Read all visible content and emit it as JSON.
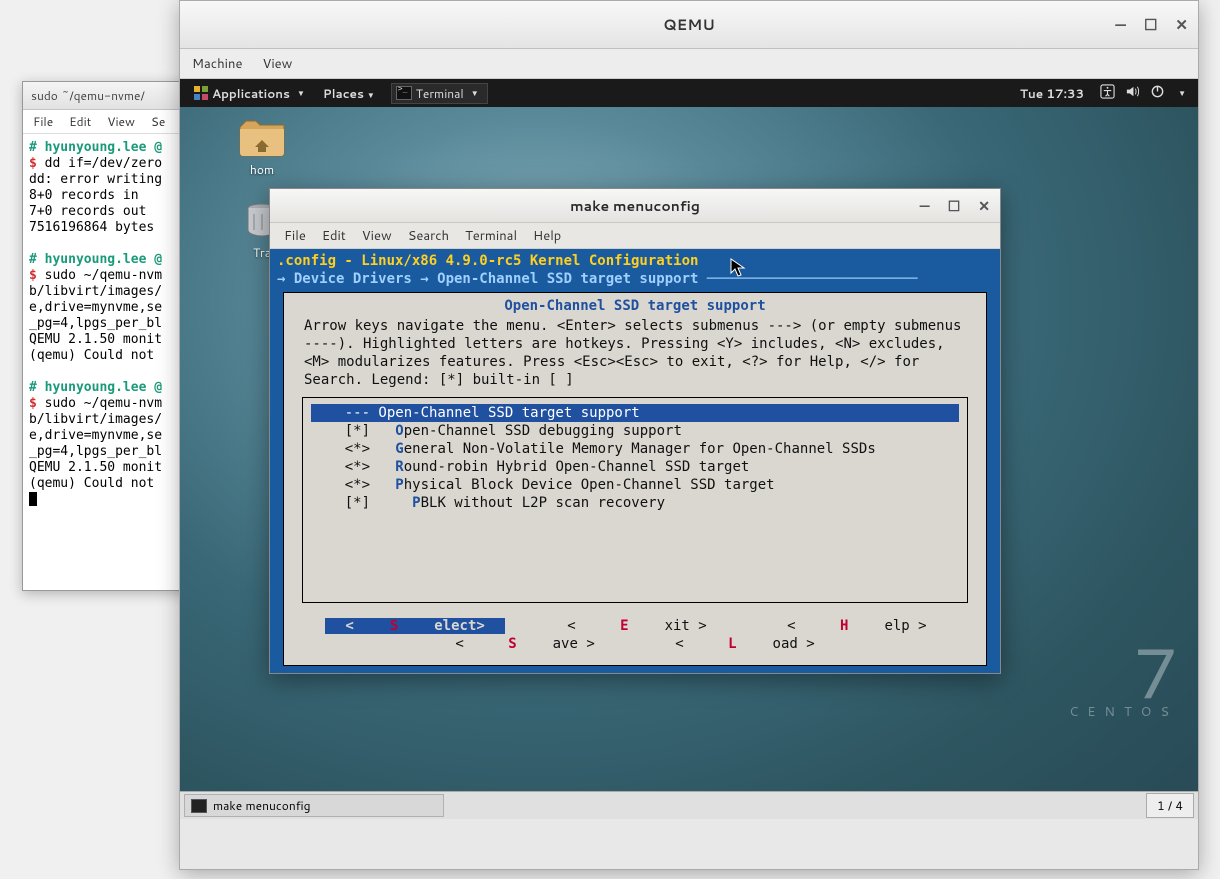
{
  "qemu": {
    "title": "QEMU",
    "menus": {
      "machine": "Machine",
      "view": "View"
    },
    "controls": {
      "min": "—",
      "max": "☐",
      "close": "✕"
    }
  },
  "gnome": {
    "apps": "Applications",
    "places": "Places",
    "terminal_launcher": "Terminal",
    "clock": "Tue 17:33",
    "desktop_icons": {
      "home": "hom",
      "trash": "Tra"
    },
    "centos": {
      "seven": "7",
      "name": "CENTOS"
    },
    "taskbar_item": "make menuconfig",
    "workspace": "1 / 4"
  },
  "menuconfig": {
    "title": "make menuconfig",
    "controls": {
      "min": "—",
      "max": "☐",
      "close": "✕"
    },
    "menubar": [
      "File",
      "Edit",
      "View",
      "Search",
      "Terminal",
      "Help"
    ],
    "header_left": " .config - Linux/x86 4.9.0-rc5 Kernel Configuration",
    "breadcrumb": "  → Device Drivers → Open-Channel SSD target support ─────────────────────────",
    "box_title": "Open-Channel SSD target support",
    "instructions": "Arrow keys navigate the menu.  <Enter> selects submenus ---> (or empty submenus ----).  Highlighted letters are hotkeys.  Pressing <Y> includes, <N> excludes, <M> modularizes features.  Press <Esc><Esc> to exit, <?> for Help, </> for Search.  Legend: [*] built-in  [ ]",
    "items": [
      {
        "mark": "---",
        "hot": "",
        "text": "Open-Channel SSD target support",
        "selected": true
      },
      {
        "mark": "[*]",
        "hot": "O",
        "text": "pen-Channel SSD debugging support"
      },
      {
        "mark": "<*>",
        "hot": "G",
        "text": "eneral Non-Volatile Memory Manager for Open-Channel SSDs"
      },
      {
        "mark": "<*>",
        "hot": "R",
        "text": "ound-robin Hybrid Open-Channel SSD target"
      },
      {
        "mark": "<*>",
        "hot": "P",
        "text": "hysical Block Device Open-Channel SSD target"
      },
      {
        "mark": "[*]",
        "hot": "P",
        "text": "BLK without L2P scan recovery",
        "indent": "  "
      }
    ],
    "buttons": {
      "select": {
        "lt": "<",
        "hot": "S",
        "rest": "elect>",
        "selected": true
      },
      "exit": {
        "pre": "< ",
        "hot": "E",
        "rest": "xit >"
      },
      "help": {
        "pre": "< ",
        "hot": "H",
        "rest": "elp >"
      },
      "save": {
        "pre": "< ",
        "hot": "S",
        "rest": "ave >"
      },
      "load": {
        "pre": "< ",
        "hot": "L",
        "rest": "oad >"
      }
    }
  },
  "host_terminal": {
    "title": "sudo ~/qemu-nvme/",
    "menus": [
      "File",
      "Edit",
      "View",
      "Se"
    ],
    "lines": [
      {
        "type": "user",
        "text": "# hyunyoung.lee @"
      },
      {
        "type": "cmd",
        "prompt": "$ ",
        "text": "dd if=/dev/zero"
      },
      {
        "type": "out",
        "text": "dd: error writing"
      },
      {
        "type": "out",
        "text": "8+0 records in"
      },
      {
        "type": "out",
        "text": "7+0 records out"
      },
      {
        "type": "out",
        "text": "7516196864 bytes "
      },
      {
        "type": "blank"
      },
      {
        "type": "user",
        "text": "# hyunyoung.lee @"
      },
      {
        "type": "cmd",
        "prompt": "$ ",
        "text": "sudo ~/qemu-nvm"
      },
      {
        "type": "out",
        "text": "b/libvirt/images/"
      },
      {
        "type": "out",
        "text": "e,drive=mynvme,se"
      },
      {
        "type": "out",
        "text": "_pg=4,lpgs_per_bl"
      },
      {
        "type": "out",
        "text": "QEMU 2.1.50 monit"
      },
      {
        "type": "out",
        "text": "(qemu) Could not "
      },
      {
        "type": "blank"
      },
      {
        "type": "user",
        "text": "# hyunyoung.lee @"
      },
      {
        "type": "cmd",
        "prompt": "$ ",
        "text": "sudo ~/qemu-nvm"
      },
      {
        "type": "out",
        "text": "b/libvirt/images/"
      },
      {
        "type": "out",
        "text": "e,drive=mynvme,se"
      },
      {
        "type": "out",
        "text": "_pg=4,lpgs_per_bl"
      },
      {
        "type": "out",
        "text": "QEMU 2.1.50 monit"
      },
      {
        "type": "out",
        "text": "(qemu) Could not "
      }
    ]
  }
}
